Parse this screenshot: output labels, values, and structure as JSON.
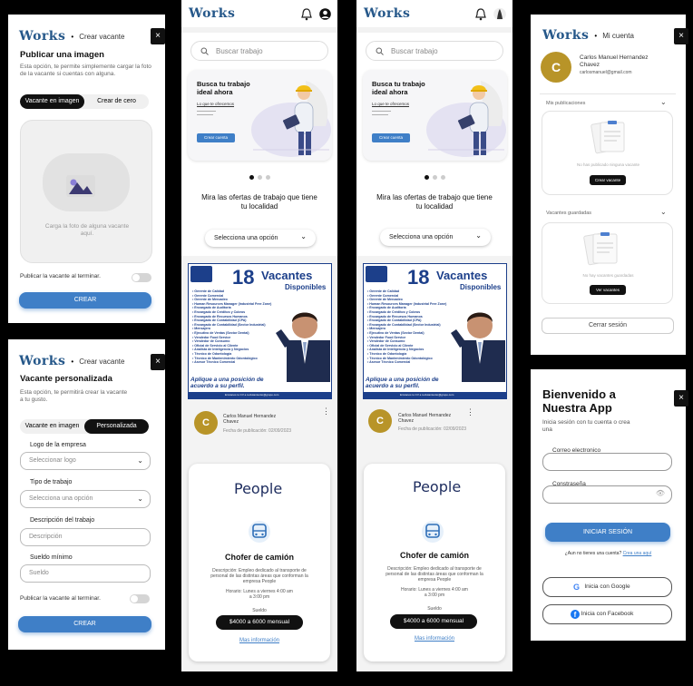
{
  "create_image": {
    "logo": "Works",
    "header_sep": "•",
    "header_title": "Crear vacante",
    "close": "×",
    "heading": "Publicar una imagen",
    "description": "Esta opción, te permite simplemente cargar la foto de la vacante si cuentas con alguna.",
    "tab_image": "Vacante en imagen",
    "tab_scratch": "Crear de cero",
    "upload_text": "Carga la foto de alguna vacante aquí.",
    "publish_label": "Publicar la vacante al terminar.",
    "create_button": "CREAR"
  },
  "create_custom": {
    "logo": "Works",
    "header_sep": "•",
    "header_title": "Crear vacante",
    "close": "×",
    "heading": "Vacante personalizada",
    "description": "Esta opción, te permitirá crear la vacante a tu gusto.",
    "tab_image": "Vacante en imagen",
    "tab_custom": "Personalizada",
    "logo_label": "Logo de la empresa",
    "logo_placeholder": "Seleccionar logo",
    "type_label": "Tipo de trabajo",
    "type_placeholder": "Selecciona una opción",
    "desc_label": "Descripción del trabajo",
    "desc_placeholder": "Descripción",
    "salary_label": "Sueldo mínimo",
    "salary_placeholder": "Sueldo",
    "publish_label": "Publicar la vacante al terminar.",
    "create_button": "CREAR"
  },
  "feed": {
    "logo": "Works",
    "search_placeholder": "Buscar trabajo",
    "hero_title": "Busca tu trabajo ideal ahora",
    "hero_sub": "Lo que te ofrecemos",
    "hero_button": "Crear cuenta",
    "offers_text": "Mira las ofertas de trabajo que tiene tu localidad",
    "select_option": "Selecciona una opción",
    "poster_number": "18",
    "poster_word": "Vacantes",
    "poster_sub": "Disponibles",
    "poster_list": [
      "Gerente de Calidad",
      "Gerente Comercial",
      "Gerente de Mercadeo",
      "Human Resources Manager (Industrial Free Zone)",
      "Encargado de Auditoría",
      "Encargado de Créditos y Cobros",
      "Encargado de Recursos Humanos",
      "Encargado de Contabilidad (CPA)",
      "Encargado de Contabilidad (Sector Industrial)",
      "Mensajero",
      "Ejecutivo de Ventas (Sector Dental)",
      "Vendedor Food Service",
      "Vendedor de Consumo",
      "Oficial de Servicio al Cliente",
      "Analista de Inteligencia y Negocios",
      "Técnico de Odontología",
      "Técnico de Mantenimiento Odontológico",
      "Asesor Técnico Comercial"
    ],
    "poster_cta": "Aplique a una posición de acuerdo a su perfil.",
    "poster_contact": "Envíanos tu CV a reclutamiento@grupo.com",
    "poster_phone": "Llámanos al 809.334.7474",
    "avatar_letter": "C",
    "author_name": "Carlos Manuel Hernandez Chavez",
    "publish_date": "Fecha de publicación: 02/09/2023",
    "company": "People",
    "job_title": "Chofer de camión",
    "job_desc": "Descripción: Empleo dedicado al transporte de personal de las distintas áreas que conforman la empresa People",
    "job_desc_alt": "Descripción: Empleo dedicado al transporte de personal de las distintas áreas que conforman la empresa People",
    "schedule": "Horario: Lunes a viernes 4:00 am a 3:00 pm",
    "schedule_alt": "Horario: Lunes a viernes 4:00 am a 3:00 pm",
    "salary_label": "Sueldo",
    "salary": "$4000 a 6000 mensual",
    "more_info": "Mas información"
  },
  "account": {
    "logo": "Works",
    "header_sep": "•",
    "header_title": "Mi cuenta",
    "close": "×",
    "avatar_letter": "C",
    "name": "Carlos Manuel Hernandez Chavez",
    "email": "carlosmanuel@gmail.com",
    "publications_title": "Mis publicaciones",
    "publications_empty": "No has publicado ninguna vacante",
    "create_vacancy": "Crear vacante",
    "saved_title": "Vacantes guardadas",
    "saved_empty": "No hay vacantes guardadas",
    "view_vacancies": "Ver vacantes",
    "logout": "Cerrar sesión"
  },
  "login": {
    "close": "×",
    "title": "Bienvenido a Nuestra App",
    "subtitle": "Inicia sesión con tu cuenta o crea una",
    "email_label": "Correo electronico",
    "password_label": "Constraseña",
    "login_button": "INICIAR SESIÓN",
    "no_account": "¿Aun no tienes una cuenta?",
    "register_link": "Crea una aquí",
    "google": "Inicia con Google",
    "facebook": "Inicia con Facebook"
  }
}
